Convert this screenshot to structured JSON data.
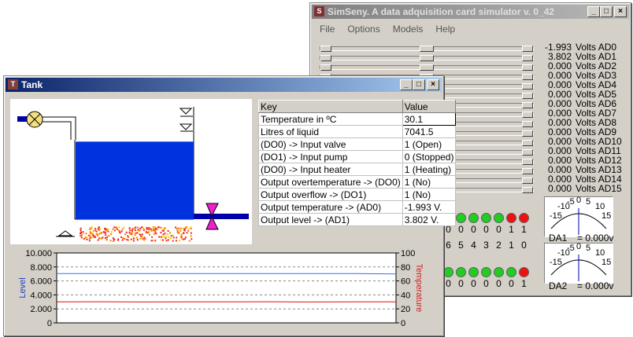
{
  "simseny": {
    "title": "SimSeny. A data adquisition card simulator v. 0_42",
    "icon": "S",
    "menu": [
      "File",
      "Options",
      "Models",
      "Help"
    ],
    "channels": [
      {
        "value": "-1.993",
        "unit": "Volts AD0",
        "level": 0.53
      },
      {
        "value": "3.802",
        "unit": "Volts AD1",
        "level": 0.53
      },
      {
        "value": "0.000",
        "unit": "Volts AD2",
        "level": 0.53
      },
      {
        "value": "0.000",
        "unit": "Volts AD3",
        "level": 0.53
      },
      {
        "value": "0.000",
        "unit": "Volts AD4",
        "level": 0.53
      },
      {
        "value": "0.000",
        "unit": "Volts AD5",
        "level": 0.53
      },
      {
        "value": "0.000",
        "unit": "Volts AD6",
        "level": 0.53
      },
      {
        "value": "0.000",
        "unit": "Volts AD7",
        "level": 0.53
      },
      {
        "value": "0.000",
        "unit": "Volts AD8",
        "level": 0.53
      },
      {
        "value": "0.000",
        "unit": "Volts AD9",
        "level": 0.53
      },
      {
        "value": "0.000",
        "unit": "Volts AD10",
        "level": 0.53
      },
      {
        "value": "0.000",
        "unit": "Volts AD11",
        "level": 0.53
      },
      {
        "value": "0.000",
        "unit": "Volts AD12",
        "level": 0.53
      },
      {
        "value": "0.000",
        "unit": "Volts AD13",
        "level": 0.53
      },
      {
        "value": "0.000",
        "unit": "Volts AD14",
        "level": 0.53
      },
      {
        "value": "0.000",
        "unit": "Volts AD15",
        "level": 0.53
      }
    ],
    "digital_in_leds": [
      "green",
      "green",
      "green",
      "green",
      "green",
      "green",
      "red",
      "red"
    ],
    "digital_in_values": [
      "0",
      "0",
      "0",
      "0",
      "0",
      "0",
      "1",
      "1"
    ],
    "bit_labels": [
      "6",
      "5",
      "4",
      "3",
      "2",
      "1",
      "0"
    ],
    "digital_out_leds": [
      "green",
      "green",
      "green",
      "green",
      "green",
      "green",
      "green",
      "red"
    ],
    "digital_out_values": [
      "0",
      "0",
      "0",
      "0",
      "0",
      "0",
      "0",
      "1"
    ],
    "meters": [
      {
        "scale": [
          "-15",
          "-10",
          "-5",
          "0",
          "5",
          "10",
          "15"
        ],
        "label": "DA1",
        "value": "= 0.000v"
      },
      {
        "scale": [
          "-15",
          "-10",
          "-5",
          "0",
          "5",
          "10",
          "15"
        ],
        "label": "DA2",
        "value": "= 0.000v"
      }
    ],
    "colors": {
      "led_on_red": "#ee1111",
      "led_off_green": "#22cc22"
    }
  },
  "tank": {
    "title": "Tank",
    "icon": "T",
    "table": {
      "headers": [
        "Key",
        "Value"
      ],
      "rows": [
        {
          "key": "Temperature in ºC",
          "value": "30.1"
        },
        {
          "key": "Litres of liquid",
          "value": "7041.5"
        },
        {
          "key": "(DO0) -> Input valve",
          "value": "1 (Open)"
        },
        {
          "key": "(DO1) -> Input pump",
          "value": "0 (Stopped)"
        },
        {
          "key": "(DO0) -> Input heater",
          "value": "1 (Heating)"
        },
        {
          "key": "Output overtemperature -> (DO0)",
          "value": "1 (No)"
        },
        {
          "key": "Output overflow -> (DO1)",
          "value": "1 (No)"
        },
        {
          "key": "Output temperature -> (AD0)",
          "value": "-1.993 V."
        },
        {
          "key": "Output level -> (AD1)",
          "value": "3.802 V."
        }
      ]
    },
    "tank_level_fraction": 0.7,
    "chart_data": {
      "type": "line",
      "ylabel": "Level",
      "y2label": "Temperature",
      "yticks": [
        "10.000",
        "8.000",
        "6.000",
        "4.000",
        "2.000",
        "0"
      ],
      "y2ticks": [
        "100",
        "80",
        "60",
        "40",
        "20",
        "0"
      ],
      "ylim": [
        0,
        10
      ],
      "y2lim": [
        0,
        100
      ],
      "series": [
        {
          "axis": "left",
          "color": "#3070ff",
          "values": [
            7.05,
            7.05,
            7.04,
            7.05,
            7.04,
            7.05,
            7.04,
            7.04,
            7.0
          ]
        },
        {
          "axis": "right",
          "color": "#e01010",
          "values": [
            30,
            30.2,
            29.9,
            30.1,
            30,
            30.2,
            29.9,
            30.1,
            30
          ]
        }
      ],
      "grid": true,
      "colors": {
        "left_axis": "#2040c0",
        "right_axis": "#d02020"
      }
    }
  }
}
